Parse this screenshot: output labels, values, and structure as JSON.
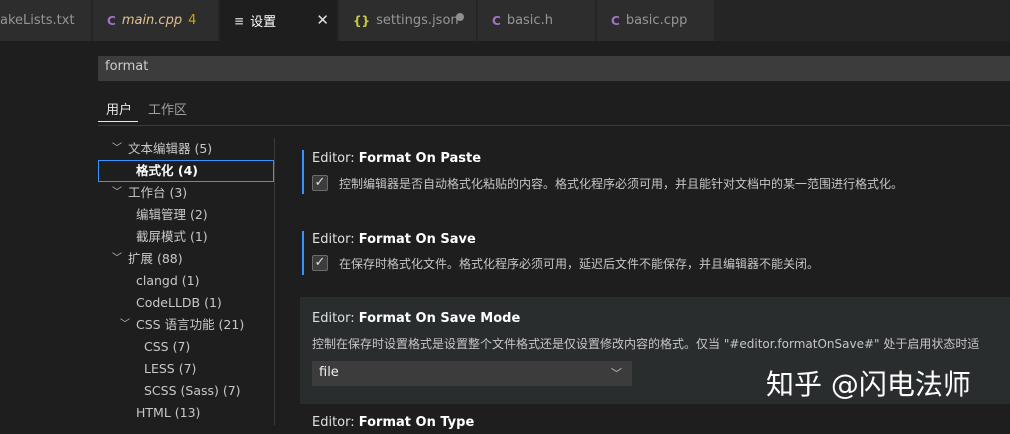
{
  "tabs": [
    {
      "label": "akeLists.txt",
      "icon": "",
      "active": false
    },
    {
      "label": "main.cpp",
      "badge": "4",
      "icon": "C",
      "active": false
    },
    {
      "label": "设置",
      "icon": "≡",
      "active": true
    },
    {
      "label": "settings.json",
      "icon": "{}",
      "active": false
    },
    {
      "label": "basic.h",
      "icon": "C",
      "active": false
    },
    {
      "label": "basic.cpp",
      "icon": "C",
      "active": false
    }
  ],
  "search": {
    "value": "format"
  },
  "scopes": [
    {
      "label": "用户"
    },
    {
      "label": "工作区"
    }
  ],
  "toc": [
    {
      "label": "文本编辑器 (5)"
    },
    {
      "label": "格式化 (4)"
    },
    {
      "label": "工作台 (3)"
    },
    {
      "label": "编辑管理 (2)"
    },
    {
      "label": "截屏模式 (1)"
    },
    {
      "label": "扩展 (88)"
    },
    {
      "label": "clangd (1)"
    },
    {
      "label": "CodeLLDB (1)"
    },
    {
      "label": "CSS 语言功能 (21)"
    },
    {
      "label": "CSS (7)"
    },
    {
      "label": "LESS (7)"
    },
    {
      "label": "SCSS (Sass) (7)"
    },
    {
      "label": "HTML (13)"
    }
  ],
  "settings": [
    {
      "category": "Editor: ",
      "name": "Format On Paste",
      "description": "控制编辑器是否自动格式化粘贴的内容。格式化程序必须可用，并且能针对文档中的某一范围进行格式化。",
      "checked": true
    },
    {
      "category": "Editor: ",
      "name": "Format On Save",
      "description": "在保存时格式化文件。格式化程序必须可用，延迟后文件不能保存，并且编辑器不能关闭。",
      "checked": true
    },
    {
      "category": "Editor: ",
      "name": "Format On Save Mode",
      "description": "控制在保存时设置格式是设置整个文件格式还是仅设置修改内容的格式。仅当 \"#editor.formatOnSave#\" 处于启用状态时适",
      "value": "file"
    },
    {
      "category": "Editor: ",
      "name": "Format On Type"
    }
  ],
  "watermark": "知乎 @闪电法师",
  "colors": {
    "accent": "#3794ff",
    "background": "#1e1e1e",
    "modified": "#cca700"
  }
}
